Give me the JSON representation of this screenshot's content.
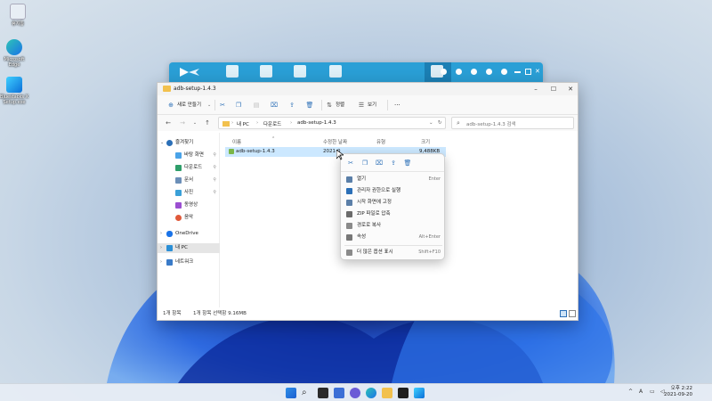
{
  "desktop": {
    "icons": [
      {
        "label": "휴지통"
      },
      {
        "label": "Microsoft Edge"
      },
      {
        "label": "Bluestacks X Setup.exe"
      }
    ]
  },
  "explorer": {
    "title": "adb-setup-1.4.3",
    "commands": {
      "new_label": "새로 만들기",
      "sort_label": "정렬",
      "view_label": "보기",
      "more_label": "···"
    },
    "address": {
      "crumbs": [
        "내 PC",
        "다운로드",
        "adb-setup-1.4.3"
      ]
    },
    "search": {
      "placeholder": "adb-setup-1.4.3 검색"
    },
    "sidebar": {
      "quick_access": "즐겨찾기",
      "items": [
        {
          "label": "바탕 화면"
        },
        {
          "label": "다운로드"
        },
        {
          "label": "문서"
        },
        {
          "label": "사진"
        },
        {
          "label": "동영상"
        },
        {
          "label": "음악"
        }
      ],
      "onedrive": "OneDrive",
      "this_pc": "내 PC",
      "network": "네트워크"
    },
    "columns": {
      "name": "이름",
      "modified": "수정한 날짜",
      "type": "유형",
      "size": "크기"
    },
    "files": [
      {
        "name": "adb-setup-1.4.3",
        "modified": "2021-0",
        "size": "9,488KB"
      }
    ],
    "status": {
      "count": "1개 항목",
      "selection": "1개 항목 선택함 9.16MB"
    }
  },
  "context_menu": {
    "items": [
      {
        "label": "열기",
        "shortcut": "Enter"
      },
      {
        "label": "관리자 권한으로 실행",
        "shortcut": ""
      },
      {
        "label": "시작 화면에 고정",
        "shortcut": ""
      },
      {
        "label": "ZIP 파일로 압축",
        "shortcut": ""
      },
      {
        "label": "경로로 복사",
        "shortcut": ""
      },
      {
        "label": "속성",
        "shortcut": "Alt+Enter"
      },
      {
        "label": "더 많은 옵션 표시",
        "shortcut": "Shift+F10"
      }
    ]
  },
  "taskbar": {
    "tray_caret": "^",
    "time": "오후 2:22",
    "date": "2021-09-20"
  },
  "colors": {
    "accent": "#2a9fd6",
    "selection": "#cce8ff",
    "folder": "#f2c14e"
  }
}
